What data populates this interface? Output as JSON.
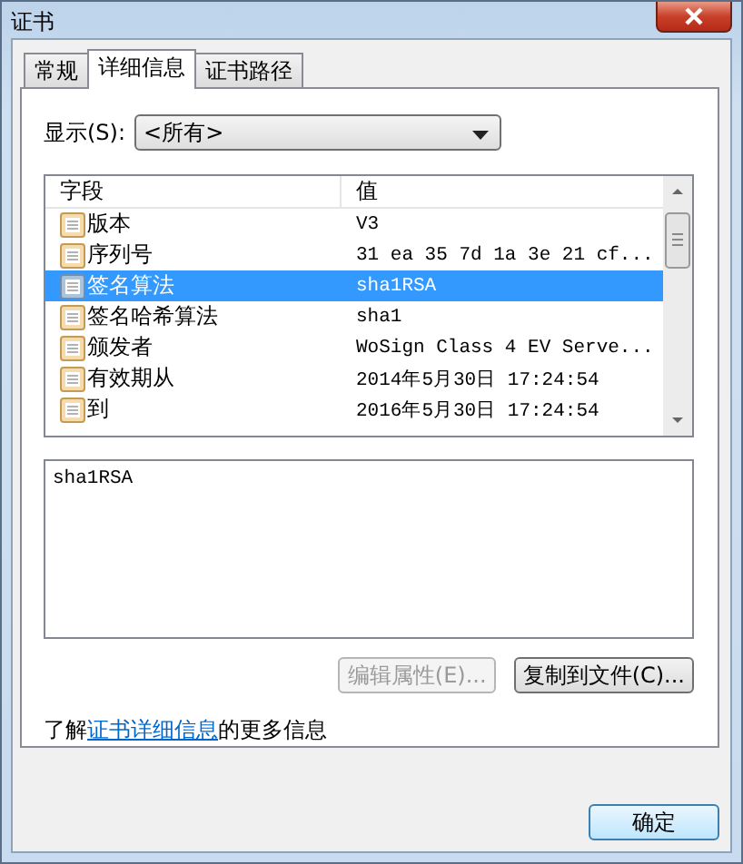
{
  "window": {
    "title": "证书"
  },
  "tabs": [
    {
      "label": "常规",
      "selected": false
    },
    {
      "label": "详细信息",
      "selected": true
    },
    {
      "label": "证书路径",
      "selected": false
    }
  ],
  "show": {
    "label": "显示(S):",
    "value": "<所有>"
  },
  "table": {
    "columns": [
      "字段",
      "值"
    ],
    "rows": [
      {
        "field": "版本",
        "value": "V3",
        "selected": false
      },
      {
        "field": "序列号",
        "value": "31 ea 35 7d 1a 3e 21 cf...",
        "selected": false
      },
      {
        "field": "签名算法",
        "value": "sha1RSA",
        "selected": true
      },
      {
        "field": "签名哈希算法",
        "value": "sha1",
        "selected": false
      },
      {
        "field": "颁发者",
        "value": "WoSign Class 4 EV Serve...",
        "selected": false
      },
      {
        "field": "有效期从",
        "value": "2014年5月30日 17:24:54",
        "selected": false
      },
      {
        "field": "到",
        "value": "2016年5月30日 17:24:54",
        "selected": false
      }
    ]
  },
  "detail": {
    "value": "sha1RSA"
  },
  "buttons": [
    {
      "label": "编辑属性(E)...",
      "disabled": true
    },
    {
      "label": "复制到文件(C)...",
      "disabled": false
    }
  ],
  "help": {
    "before": "了解",
    "link": "证书详细信息",
    "after": "的更多信息"
  },
  "ok_button": "确定"
}
